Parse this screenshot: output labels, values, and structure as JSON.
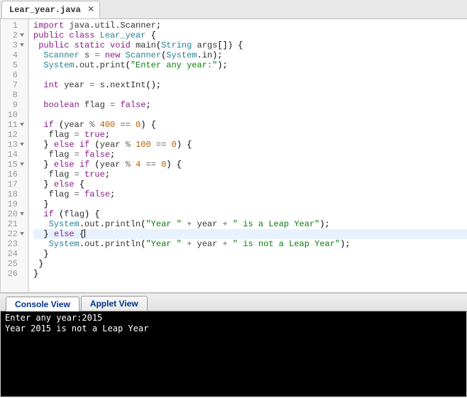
{
  "tab": {
    "title": "Lear_year.java",
    "close": "×"
  },
  "code": {
    "lines": [
      {
        "num": "1",
        "fold": false,
        "html": "<span class='kw'>import</span> <span class='ident'>java.util.Scanner</span>;"
      },
      {
        "num": "2",
        "fold": true,
        "html": "<span class='kw'>public</span> <span class='kw'>class</span> <span class='type'>Lear_year</span> {"
      },
      {
        "num": "3",
        "fold": true,
        "html": " <span class='kw'>public</span> <span class='kw'>static</span> <span class='kw'>void</span> <span class='ident'>main</span>(<span class='type'>String</span> <span class='ident'>args</span>[]) {"
      },
      {
        "num": "4",
        "fold": false,
        "html": "  <span class='type'>Scanner</span> <span class='ident'>s</span> <span class='op'>=</span> <span class='kw'>new</span> <span class='type'>Scanner</span>(<span class='builtin'>System</span>.<span class='ident'>in</span>);"
      },
      {
        "num": "5",
        "fold": false,
        "html": "  <span class='builtin'>System</span>.<span class='ident'>out</span>.<span class='ident'>print</span>(<span class='str'>\"Enter any year:\"</span>);"
      },
      {
        "num": "6",
        "fold": false,
        "html": ""
      },
      {
        "num": "7",
        "fold": false,
        "html": "  <span class='kw'>int</span> <span class='ident'>year</span> <span class='op'>=</span> <span class='ident'>s</span>.<span class='ident'>nextInt</span>();"
      },
      {
        "num": "8",
        "fold": false,
        "html": ""
      },
      {
        "num": "9",
        "fold": false,
        "html": "  <span class='kw'>boolean</span> <span class='ident'>flag</span> <span class='op'>=</span> <span class='kw'>false</span>;"
      },
      {
        "num": "10",
        "fold": false,
        "html": ""
      },
      {
        "num": "11",
        "fold": true,
        "html": "  <span class='kw'>if</span> (<span class='ident'>year</span> <span class='op'>%</span> <span class='num'>400</span> <span class='op'>==</span> <span class='num'>0</span>) {"
      },
      {
        "num": "12",
        "fold": false,
        "html": "   <span class='ident'>flag</span> <span class='op'>=</span> <span class='kw'>true</span>;"
      },
      {
        "num": "13",
        "fold": true,
        "html": "  } <span class='kw'>else</span> <span class='kw'>if</span> (<span class='ident'>year</span> <span class='op'>%</span> <span class='num'>100</span> <span class='op'>==</span> <span class='num'>0</span>) {"
      },
      {
        "num": "14",
        "fold": false,
        "html": "   <span class='ident'>flag</span> <span class='op'>=</span> <span class='kw'>false</span>;"
      },
      {
        "num": "15",
        "fold": true,
        "html": "  } <span class='kw'>else</span> <span class='kw'>if</span> (<span class='ident'>year</span> <span class='op'>%</span> <span class='num'>4</span> <span class='op'>==</span> <span class='num'>0</span>) {"
      },
      {
        "num": "16",
        "fold": false,
        "html": "   <span class='ident'>flag</span> <span class='op'>=</span> <span class='kw'>true</span>;"
      },
      {
        "num": "17",
        "fold": false,
        "html": "  } <span class='kw'>else</span> {"
      },
      {
        "num": "18",
        "fold": false,
        "html": "   <span class='ident'>flag</span> <span class='op'>=</span> <span class='kw'>false</span>;"
      },
      {
        "num": "19",
        "fold": false,
        "html": "  }"
      },
      {
        "num": "20",
        "fold": true,
        "html": "  <span class='kw'>if</span> (<span class='ident'>flag</span>) {"
      },
      {
        "num": "21",
        "fold": false,
        "html": "   <span class='builtin'>System</span>.<span class='ident'>out</span>.<span class='ident'>println</span>(<span class='str'>\"Year \"</span> <span class='op'>+</span> <span class='ident'>year</span> <span class='op'>+</span> <span class='str'>\" is a Leap Year\"</span>);"
      },
      {
        "num": "22",
        "fold": true,
        "active": true,
        "html": "  } <span class='kw'>else</span> {<span class='cursor'></span>"
      },
      {
        "num": "23",
        "fold": false,
        "html": "   <span class='builtin'>System</span>.<span class='ident'>out</span>.<span class='ident'>println</span>(<span class='str'>\"Year \"</span> <span class='op'>+</span> <span class='ident'>year</span> <span class='op'>+</span> <span class='str'>\" is not a Leap Year\"</span>);"
      },
      {
        "num": "24",
        "fold": false,
        "html": "  }"
      },
      {
        "num": "25",
        "fold": false,
        "html": " }"
      },
      {
        "num": "26",
        "fold": false,
        "html": "}"
      }
    ]
  },
  "consoleTabs": {
    "view": "Console View",
    "applet": "Applet View"
  },
  "consoleOutput": "Enter any year:2015\nYear 2015 is not a Leap Year"
}
